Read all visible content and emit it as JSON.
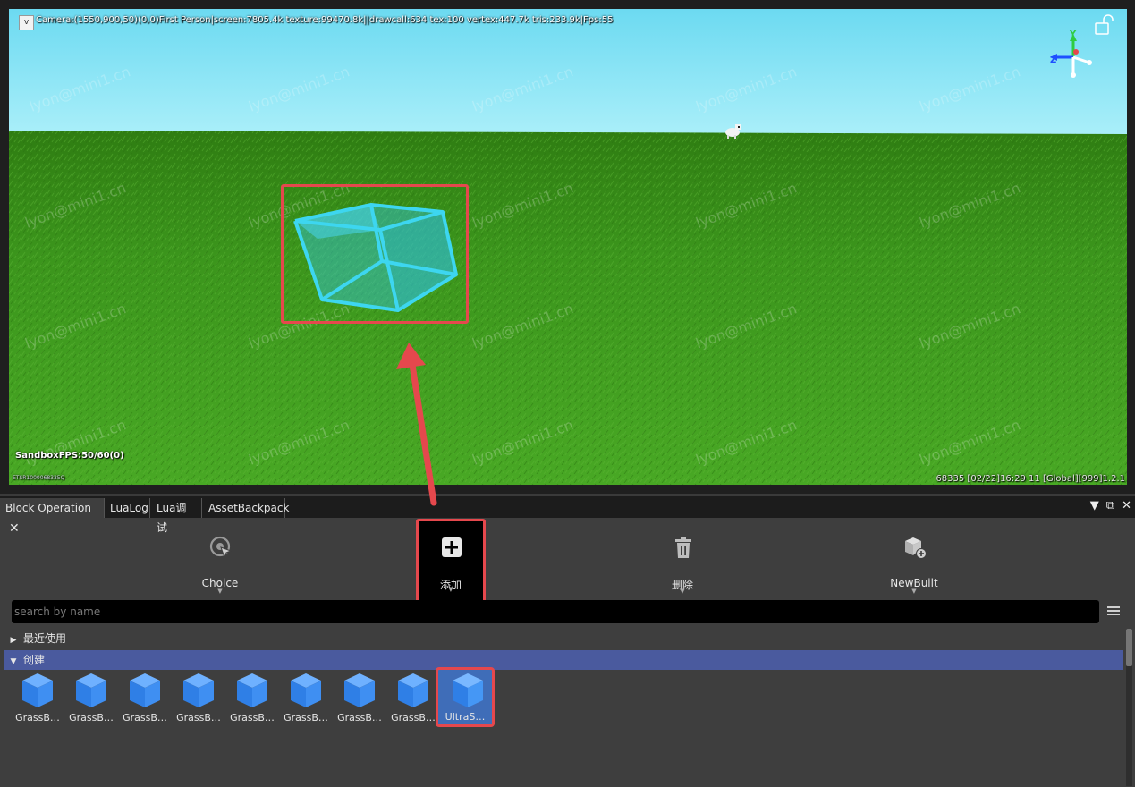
{
  "viewport": {
    "hud_top": "Camera:(1550,900,50)(0,0)First Person|screen:7805.4k texture:99470.8k||drawcall:634 tex:100 vertex:447.7k tris:233.9k|Fps:55",
    "hud_dropdown": "v",
    "sandbox_fps": "SandboxFPS:50/60(0)",
    "tiny_id": "ETSR1000068335Q",
    "status_right": "68335   [02/22]16:29 11   [Global][999]1.2.1",
    "watermark": "lyon@mini1.cn",
    "axis_z_label": "Z",
    "axis_y_label": "Y",
    "colors": {
      "highlight": "#e5484d",
      "sky": "#7fe2f4",
      "ground": "#3c9a1e",
      "cube": "#32c8e6"
    }
  },
  "panel": {
    "tabs": [
      {
        "label": "Block Operation",
        "closable": true,
        "active": true
      },
      {
        "label": "LuaLog"
      },
      {
        "label": "Lua调试"
      },
      {
        "label": "AssetBackpack"
      }
    ],
    "window_controls": {
      "menu": "▼",
      "restore": "⧉",
      "close": "✕"
    },
    "toolbar": {
      "choice": "Choice",
      "add": "添加",
      "delete": "删除",
      "newbuilt": "NewBuilt"
    },
    "search": {
      "placeholder": "search by name",
      "value": ""
    },
    "tree": {
      "recent": "最近使用",
      "create": "创建"
    },
    "items": [
      {
        "name": "GrassB…"
      },
      {
        "name": "GrassB…"
      },
      {
        "name": "GrassB…"
      },
      {
        "name": "GrassB…"
      },
      {
        "name": "GrassB…"
      },
      {
        "name": "GrassB…"
      },
      {
        "name": "GrassB…"
      },
      {
        "name": "GrassB…"
      },
      {
        "name": "UltraS…",
        "selected": true
      }
    ]
  }
}
